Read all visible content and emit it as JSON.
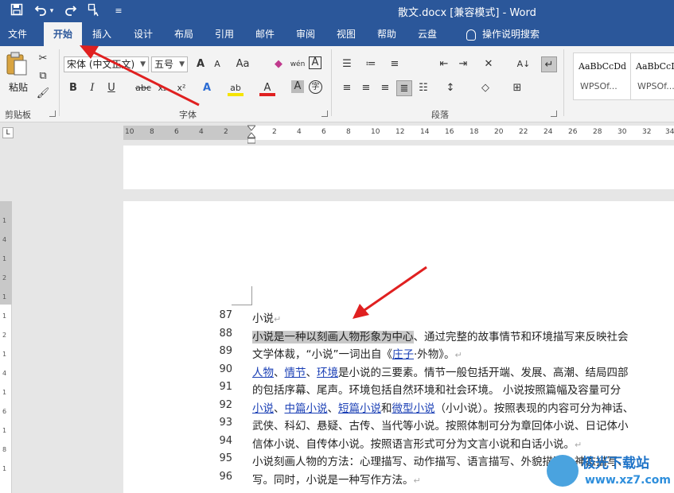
{
  "title_bar": {
    "title": "散文.docx [兼容模式] - Word",
    "quick_access": [
      "save-icon",
      "undo-icon",
      "redo-icon",
      "touch-mode-icon",
      "customize-icon"
    ]
  },
  "tabs": [
    {
      "label": "文件"
    },
    {
      "label": "开始",
      "active": true
    },
    {
      "label": "插入"
    },
    {
      "label": "设计"
    },
    {
      "label": "布局"
    },
    {
      "label": "引用"
    },
    {
      "label": "邮件"
    },
    {
      "label": "审阅"
    },
    {
      "label": "视图"
    },
    {
      "label": "帮助"
    },
    {
      "label": "云盘"
    },
    {
      "label": "操作说明搜索"
    }
  ],
  "ribbon": {
    "clipboard": {
      "paste_label": "粘贴",
      "group_label": "剪贴板"
    },
    "font": {
      "font_name": "宋体 (中文正文)",
      "font_size": "五号",
      "group_label": "字体",
      "grow_label": "A",
      "shrink_label": "A",
      "case_label": "Aa",
      "bold": "B",
      "italic": "I",
      "underline": "U",
      "strike": "abc",
      "subscript": "x₂",
      "superscript": "x²",
      "pinyin_label": "wén",
      "border_label": "A",
      "effects_label": "A",
      "highlight_label": "ab",
      "color_label": "A",
      "shading_label": "A",
      "enclose_label": "字"
    },
    "paragraph": {
      "group_label": "段落"
    },
    "styles": [
      {
        "sample": "AaBbCcDd",
        "name": "WPSOf..."
      },
      {
        "sample": "AaBbCcDd",
        "name": "WPSOf..."
      }
    ],
    "accent_color": "#2b579a"
  },
  "ruler": {
    "numbers": [
      "10",
      "8",
      "6",
      "4",
      "2",
      "2",
      "4",
      "6",
      "8",
      "10",
      "12",
      "14",
      "16",
      "18",
      "20",
      "22",
      "24",
      "26",
      "28",
      "30",
      "32",
      "34"
    ],
    "corner_label": "L"
  },
  "vertical_ruler": {
    "numbers": [
      "1",
      "4",
      "1",
      "2",
      "1",
      "1",
      "2",
      "1",
      "4",
      "1",
      "6",
      "1",
      "8",
      "1"
    ]
  },
  "document": {
    "lines": [
      {
        "num": "87",
        "segments": [
          {
            "text": "小说"
          }
        ],
        "pmark": "↵"
      },
      {
        "num": "88",
        "segments": [
          {
            "text": "小说是一种以刻画人物形象为中心",
            "highlight": true
          },
          {
            "text": "、通过完整的故事情节和环境描写来反映社会"
          }
        ],
        "pmark": ""
      },
      {
        "num": "89",
        "segments": [
          {
            "text": "文学体裁，“小说”一词出自《"
          },
          {
            "text": "庄子",
            "link": true
          },
          {
            "text": "·外物》。"
          }
        ],
        "pmark": "↵"
      },
      {
        "num": "90",
        "segments": [
          {
            "text": "人物",
            "link": true
          },
          {
            "text": "、"
          },
          {
            "text": "情节",
            "link": true
          },
          {
            "text": "、"
          },
          {
            "text": "环境",
            "link": true
          },
          {
            "text": "是小说的三要素。情节一般包括开端、发展、高潮、结局四部"
          }
        ],
        "pmark": ""
      },
      {
        "num": "91",
        "segments": [
          {
            "text": "的包括序幕、尾声。环境包括自然环境和社会环境。 小说按照篇幅及容量可分"
          }
        ],
        "pmark": ""
      },
      {
        "num": "92",
        "segments": [
          {
            "text": "小说",
            "link": true
          },
          {
            "text": "、"
          },
          {
            "text": "中篇小说",
            "link": true
          },
          {
            "text": "、"
          },
          {
            "text": "短篇小说",
            "link": true
          },
          {
            "text": "和"
          },
          {
            "text": "微型小说",
            "link": true
          },
          {
            "text": "（小小说）。按照表现的内容可分为神话、"
          }
        ],
        "pmark": ""
      },
      {
        "num": "93",
        "segments": [
          {
            "text": "武侠、科幻、悬疑、古传、当代等小说。按照体制可分为章回体小说、日记体小"
          }
        ],
        "pmark": ""
      },
      {
        "num": "94",
        "segments": [
          {
            "text": "信体小说、自传体小说。按照语言形式可分为文言小说和白话小说。"
          }
        ],
        "pmark": "↵"
      },
      {
        "num": "95",
        "segments": [
          {
            "text": "小说刻画人物的方法：心理描写、动作描写、语言描写、外貌描写、神态描写、"
          }
        ],
        "pmark": ""
      },
      {
        "num": "96",
        "segments": [
          {
            "text": "写。同时，小说是一种写作方法。"
          }
        ],
        "pmark": "↵"
      }
    ]
  },
  "watermark": {
    "text": "极光下载站",
    "url": "www.xz7.com"
  },
  "annotation_color": "#e02020"
}
